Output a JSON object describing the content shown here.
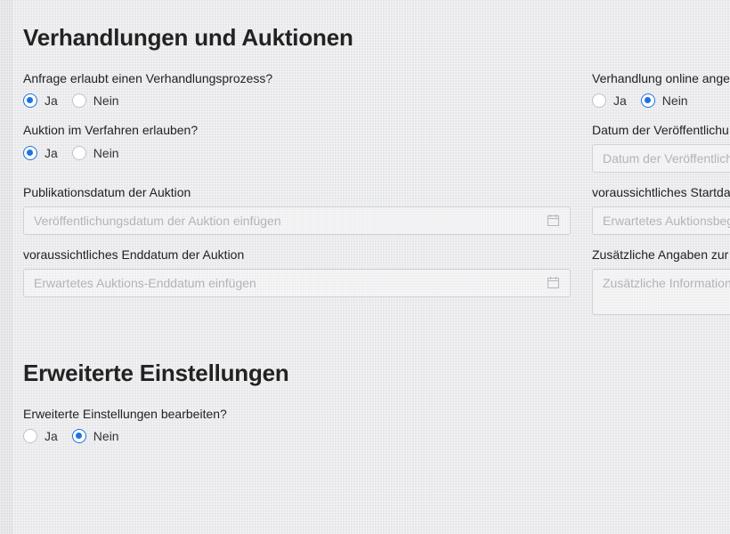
{
  "section1": {
    "title": "Verhandlungen und Auktionen",
    "left": {
      "q1": {
        "label": "Anfrage erlaubt einen Verhandlungsprozess?",
        "options": [
          "Ja",
          "Nein"
        ],
        "selected": "Ja"
      },
      "q2": {
        "label": "Auktion im Verfahren erlauben?",
        "options": [
          "Ja",
          "Nein"
        ],
        "selected": "Ja"
      },
      "pub_date": {
        "label": "Publikationsdatum der Auktion",
        "placeholder": "Veröffentlichungsdatum der Auktion einfügen",
        "icon": "calendar-icon"
      },
      "end_date": {
        "label": "voraussichtliches Enddatum der Auktion",
        "placeholder": "Erwartetes Auktions-Enddatum einfügen",
        "icon": "calendar-icon"
      }
    },
    "right": {
      "q1": {
        "label": "Verhandlung online ange",
        "options": [
          "Ja",
          "Nein"
        ],
        "selected": "Nein"
      },
      "date_pub": {
        "label": "Datum der Veröffentlichu",
        "placeholder": "Datum der Veröffentlich"
      },
      "start_date": {
        "label": "voraussichtliches Startda",
        "placeholder": "Erwartetes Auktionsbeg"
      },
      "extra": {
        "label": "Zusätzliche Angaben zur",
        "placeholder": "Zusätzliche Information"
      }
    }
  },
  "section2": {
    "title": "Erweiterte Einstellungen",
    "q1": {
      "label": "Erweiterte Einstellungen bearbeiten?",
      "options": [
        "Ja",
        "Nein"
      ],
      "selected": "Nein"
    }
  },
  "colors": {
    "accent": "#1e72e0",
    "text": "#222222",
    "placeholder": "#b1b4b8",
    "border": "#cfd2d6"
  }
}
